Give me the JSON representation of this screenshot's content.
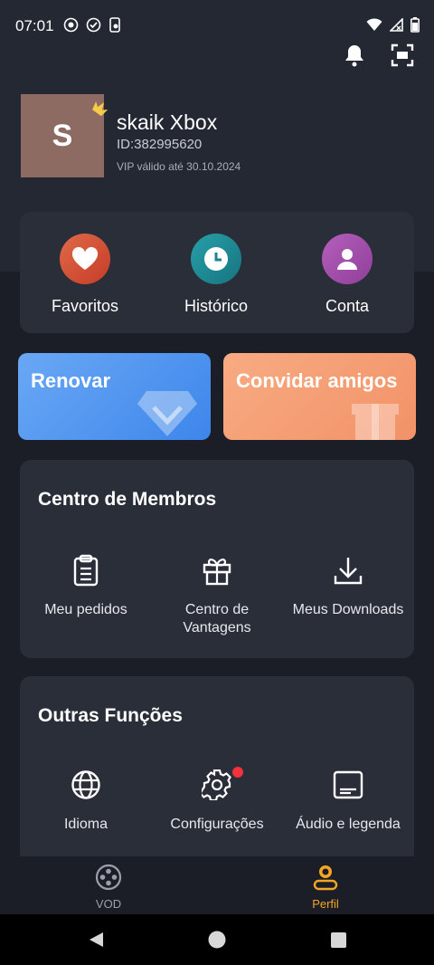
{
  "status_bar": {
    "time": "07:01"
  },
  "profile": {
    "avatar_initial": "S",
    "username": "skaik Xbox",
    "id": "ID:382995620",
    "vip": "VIP válido até 30.10.2024"
  },
  "quick_actions": [
    {
      "label": "Favoritos",
      "icon": "heart-icon",
      "color": "#e0523a"
    },
    {
      "label": "Histórico",
      "icon": "clock-icon",
      "color": "#1f8f9a"
    },
    {
      "label": "Conta",
      "icon": "person-icon",
      "color": "#a84fb0"
    }
  ],
  "promos": {
    "renew": {
      "label": "Renovar",
      "color": "#5a9bf0"
    },
    "invite": {
      "label": "Convidar amigos",
      "color": "#f4a07a"
    }
  },
  "members_center": {
    "title": "Centro de Membros",
    "items": [
      {
        "label": "Meu pedidos",
        "icon": "clipboard-icon"
      },
      {
        "label": "Centro de Vantagens",
        "icon": "gift-icon"
      },
      {
        "label": "Meus Downloads",
        "icon": "download-icon"
      }
    ]
  },
  "other_functions": {
    "title": "Outras Funções",
    "items": [
      {
        "label": "Idioma",
        "icon": "globe-icon"
      },
      {
        "label": "Configurações",
        "icon": "gear-icon"
      },
      {
        "label": "Áudio e legenda",
        "icon": "subtitles-icon"
      }
    ]
  },
  "bottom_nav": {
    "vod": "VOD",
    "profile": "Perfil",
    "active_color": "#f5a623"
  }
}
